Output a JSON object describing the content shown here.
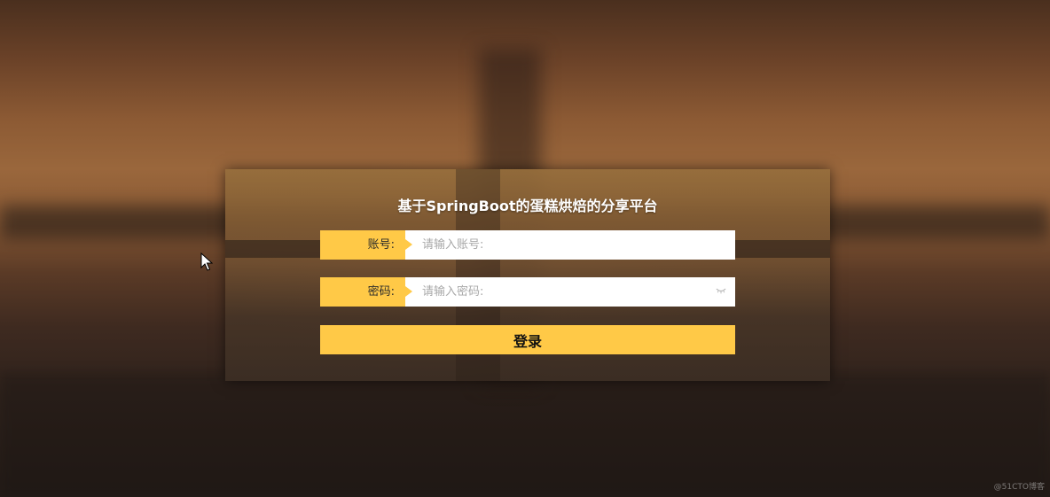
{
  "page": {
    "title": "基于SpringBoot的蛋糕烘焙的分享平台"
  },
  "login_form": {
    "username_label": "账号:",
    "username_placeholder": "请输入账号:",
    "password_label": "密码:",
    "password_placeholder": "请输入密码:",
    "submit_label": "登录"
  },
  "watermark": "@51CTO博客",
  "colors": {
    "accent": "#ffc947",
    "input_bg": "#ffffff",
    "title_text": "#ffffff"
  },
  "icons": [
    "eye-closed-icon",
    "mouse-cursor-icon"
  ]
}
